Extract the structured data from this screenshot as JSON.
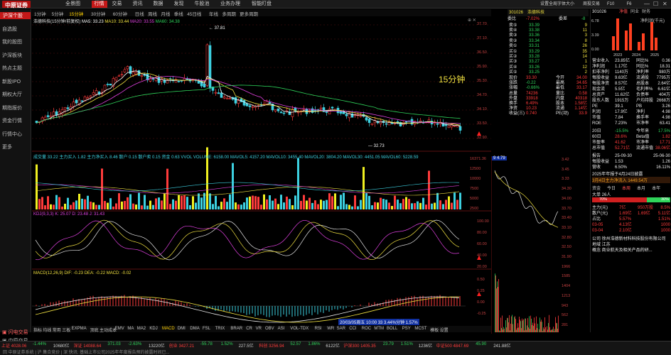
{
  "app": {
    "logo": "中原证券",
    "menu": [
      "全景图",
      "行情",
      "交易",
      "资讯",
      "数据",
      "发现",
      "牛股池",
      "业务办理",
      "智能盯盘"
    ],
    "active_menu": "行情",
    "right_menu": [
      "设置全局字体大小",
      "周投交易",
      "F10",
      "F6"
    ]
  },
  "left_nav": [
    "沪深个股",
    "自选股",
    "我的股图",
    "沪深板块",
    "热点主题",
    "新股IPO",
    "期权大厅",
    "期指报价",
    "资金行情",
    "行情中心",
    "更多"
  ],
  "left_nav_bottom": [
    "闪电交易",
    "中原交易"
  ],
  "periods": [
    "1分钟",
    "5分钟",
    "15分钟",
    "30分钟",
    "60分钟",
    "日线",
    "周线",
    "月线",
    "季线",
    "45日线",
    "年线",
    "多周期",
    "更多周期"
  ],
  "active_period": "15分钟",
  "main_chart": {
    "title": "浩德科技(15分钟/前复权)",
    "ma": [
      {
        "label": "MA5: 33.23",
        "color": "#ffffff"
      },
      {
        "label": "MA10: 33.44",
        "color": "#f0e040"
      },
      {
        "label": "MA20: 33.55",
        "color": "#e040e0"
      },
      {
        "label": "MA60: 34.38",
        "color": "#2fd35a"
      }
    ],
    "high_label": "37.81",
    "low_label": "32.73",
    "period_badge": "15分钟",
    "y_ticks": [
      "37.70",
      "37.10",
      "36.50",
      "35.90",
      "35.30",
      "34.70",
      "34.10",
      "33.50",
      "32.90"
    ]
  },
  "vol_panel": {
    "legend": "成交量 33.22  主力买入 1.82  主力净买入 8.46  散户 0.15  散户卖 0.15  资金 0.63  VVOL  VOLUME: 6158.00  MAVOL5: 4157.20  MAVOL10: 3455.40  MAVOL20: 3804.20  MAVOL30: 4451.05  MAVOL60: 5228.59",
    "y_ticks": [
      "16371.36",
      "12500",
      "10000",
      "7500",
      "5000",
      "2500"
    ]
  },
  "kdj_panel": {
    "legend": "KDJ(9,3,3)  K: 25.07  D: 23.48  J: 31.43",
    "y_ticks": [
      "100.00",
      "80.00",
      "60.00",
      "40.00",
      "20.00"
    ]
  },
  "macd_panel": {
    "legend": "MACD(12,26,9)  DIF: -0.23  DEA: -0.22  MACD: -0.02",
    "y_ticks": [
      "0.50",
      "0.25",
      "0.00",
      "-0.25"
    ]
  },
  "crosshair_label": "20/03/05周五 10:00 33  3.44%分钟  1.57%",
  "indicators": [
    "指标",
    "均线",
    "常用",
    "三板",
    "EXPMA",
    "顶底",
    "主动成本",
    "EMV",
    "MA",
    "MA2",
    "KDJ",
    "MACD",
    "DMI",
    "DMA",
    "FSL",
    "TRIX",
    "BRAR",
    "CR",
    "VR",
    "OBV",
    "ASI",
    "VOL-TDX",
    "RSI",
    "WR",
    "SAR",
    "CCI",
    "ROC",
    "MTM",
    "BOLL",
    "PSY",
    "MCST",
    "模板",
    "设置"
  ],
  "quote": {
    "code": "301026",
    "name": "浩德科技",
    "headers": [
      "委比",
      "-7.02%",
      "委差",
      "-8"
    ],
    "asks": [
      {
        "label": "卖⑤",
        "price": "33.39",
        "vol": "9"
      },
      {
        "label": "卖④",
        "price": "33.38",
        "vol": "11"
      },
      {
        "label": "卖③",
        "price": "33.36",
        "vol": "3"
      },
      {
        "label": "卖②",
        "price": "33.34",
        "vol": "8"
      },
      {
        "label": "卖①",
        "price": "33.31",
        "vol": "26"
      }
    ],
    "bids": [
      {
        "label": "买①",
        "price": "33.29",
        "vol": "35"
      },
      {
        "label": "买②",
        "price": "33.28",
        "vol": "14"
      },
      {
        "label": "买③",
        "price": "33.27",
        "vol": "1"
      },
      {
        "label": "买④",
        "price": "33.26",
        "vol": "12"
      },
      {
        "label": "买⑤",
        "price": "33.25",
        "vol": "2"
      }
    ],
    "stats": [
      {
        "k": "现价",
        "v": "33.30",
        "k2": "今开",
        "v2": "34.00"
      },
      {
        "k": "涨跌",
        "v": "-0.22",
        "k2": "最高",
        "v2": "34.65"
      },
      {
        "k": "涨幅",
        "v": "-0.66%",
        "k2": "最低",
        "v2": "33.17"
      },
      {
        "k": "总量",
        "v": "74236",
        "k2": "量比",
        "v2": "0.58"
      },
      {
        "k": "外盘",
        "v": "33918",
        "k2": "内盘",
        "v2": "40318"
      },
      {
        "k": "换手",
        "v": "6.49%",
        "k2": "股本",
        "v2": "1.58亿"
      },
      {
        "k": "净资",
        "v": "10.23",
        "k2": "流通",
        "v2": "1.14亿"
      },
      {
        "k": "收益(三)",
        "v": "0.740",
        "k2": "PE(动)",
        "v2": "33.9"
      }
    ]
  },
  "finance": {
    "code": "301026",
    "tabs": [
      "净值",
      "同业",
      "财务"
    ],
    "chart_title": "净利润(千元)",
    "chart_years": [
      "2023",
      "2024",
      "2025"
    ],
    "chart_y": [
      "6.78",
      "3.39",
      "0.00"
    ],
    "rows": [
      {
        "k": "营业收入",
        "v": "23.85亿",
        "k2": "同比%",
        "v2": "0.36"
      },
      {
        "k": "净利润",
        "v": "1.17亿",
        "k2": "同比%",
        "v2": "18.31"
      },
      {
        "k": "扣非净利",
        "v": "1140万",
        "k2": "净利率",
        "v2": "980万"
      },
      {
        "k": "每股收益",
        "v": "9.63亿",
        "k2": "流通股",
        "v2": "7795万"
      },
      {
        "k": "每股净资",
        "v": "8.57亿",
        "k2": "总股本",
        "v2": "2.64亿"
      },
      {
        "k": "现金流",
        "v": "5.5亿",
        "k2": "毛利率%",
        "v2": "6.61亿"
      },
      {
        "k": "总资产",
        "v": "11.62亿",
        "k2": "负债率",
        "v2": "404万"
      },
      {
        "k": "股东人数",
        "v": "1915万",
        "k2": "户均持股",
        "v2": "2668万"
      },
      {
        "k": "PE",
        "v": "39.1",
        "k2": "PB",
        "v2": "3.26"
      },
      {
        "k": "利润",
        "v": "17.9亿",
        "k2": "净利",
        "v2": "4.98"
      },
      {
        "k": "市值",
        "v": "7.84",
        "k2": "换手率",
        "v2": "4.98"
      },
      {
        "k": "ROE",
        "v": "7.23%",
        "k2": "市净率",
        "v2": "63.41"
      }
    ],
    "rows2": [
      {
        "k": "20日",
        "v": "-15.5%",
        "k2": "今年来",
        "v2": "17.5%"
      },
      {
        "k": "60日",
        "v": "28.6%",
        "k2": "Beta值",
        "v2": "1.82"
      },
      {
        "k": "市盈率",
        "v": "41.62",
        "k2": "市净率",
        "v2": "17.71"
      },
      {
        "k": "总市值",
        "v": "52.71亿",
        "k2": "流通市值",
        "v2": "38.06亿"
      }
    ],
    "rows3": [
      {
        "k": "报告",
        "v": "25-09-30",
        "k2": "",
        "v2": "25-06-30"
      },
      {
        "k": "每股收益",
        "v": "1.53",
        "k2": "",
        "v2": "1.26"
      },
      {
        "k": "营收",
        "v": "6.50%",
        "k2": "",
        "v2": "16.11%"
      }
    ],
    "notice": "2025年年报于4月24日披露",
    "notice2": "3月4日主力净流入 1449.54万",
    "flow_tabs": [
      "资金",
      "今日",
      "本周",
      "本月",
      "本年"
    ],
    "flow_title": "大单 26人",
    "flow_pct": [
      "70%",
      "30%"
    ],
    "flow_rows": [
      {
        "k": "主力(元)",
        "v": "7亿",
        "k2": "",
        "v2": "950万股",
        "v3": "8.5%"
      },
      {
        "k": "散户(元)",
        "v": "1.69亿",
        "k2": "",
        "v2": "1.69亿",
        "v3": "5.11亿"
      },
      {
        "k": "占比",
        "v": "5.57%",
        "k2": "",
        "v2": "",
        "v3": "1.51%"
      }
    ],
    "date_rows": [
      {
        "k": "03-05",
        "v": "4.13亿",
        "v2": "1000"
      },
      {
        "k": "03-04",
        "v": "2.10亿",
        "v2": "1000"
      }
    ],
    "industry": "公司   徐州浩德新材料科技股份有限公司",
    "region": "地域   江苏",
    "concept": "概念   商业航天及相关产品的研..."
  },
  "mini_scale": [
    "3.42",
    "3.45",
    "3.33",
    "34.30",
    "34.00",
    "33.70",
    "33.40",
    "33.10",
    "32.80",
    "32.50",
    "31.90",
    "1966",
    "1585",
    "1404",
    "1213",
    "943",
    "562",
    "281"
  ],
  "mini_badge": "9 4.79",
  "status": {
    "row1": [
      {
        "t": "上证 4028.06",
        "c": "red"
      },
      {
        "t": "-1.44%",
        "c": "grn"
      },
      {
        "t": "10680亿",
        "c": "wht"
      },
      {
        "t": "深证 14088.64",
        "c": "red"
      },
      {
        "t": "371.03",
        "c": "grn"
      },
      {
        "t": "-2.63%",
        "c": "grn"
      },
      {
        "t": "13220亿",
        "c": "wht"
      },
      {
        "t": "创业 3427.21",
        "c": "red"
      },
      {
        "t": "-55.78",
        "c": "grn"
      },
      {
        "t": "1.52%",
        "c": "grn"
      },
      {
        "t": "227.5亿",
        "c": "wht"
      },
      {
        "t": "科创 3256.94",
        "c": "red"
      },
      {
        "t": "52.57",
        "c": "grn"
      },
      {
        "t": "1.86%",
        "c": "grn"
      },
      {
        "t": "6122亿",
        "c": "wht"
      },
      {
        "t": "沪深300 1405.35",
        "c": "red"
      },
      {
        "t": "23.79",
        "c": "grn"
      },
      {
        "t": "1.51%",
        "c": "grn"
      },
      {
        "t": "1236亿",
        "c": "wht"
      },
      {
        "t": "中证500 4847.69",
        "c": "red"
      },
      {
        "t": "45.90",
        "c": "grn"
      },
      {
        "t": "241.88亿",
        "c": "wht"
      }
    ],
    "row2": "回 中原证券系统  |  沪  集合竞价  |  深  快讯: 基础上市公司2025年年度报告预约披露时间已..."
  },
  "colors": {
    "up": "#ff3b3b",
    "down": "#2fd35a",
    "bg": "#000000",
    "accent": "#c41818"
  }
}
